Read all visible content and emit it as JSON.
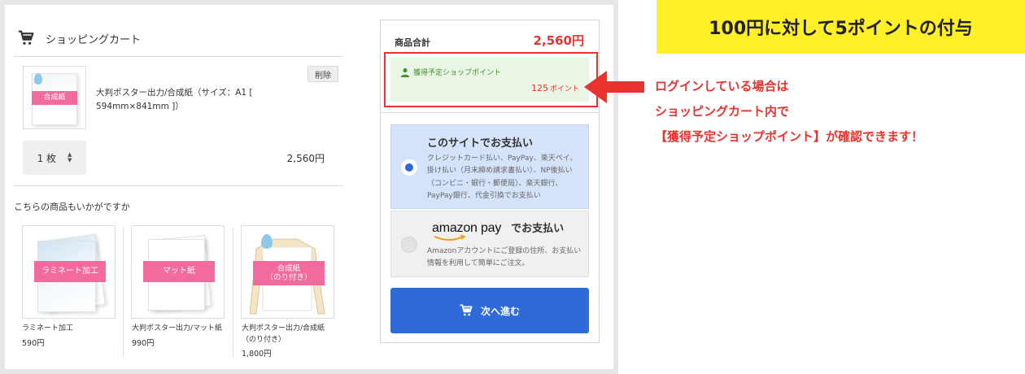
{
  "cart": {
    "title": "ショッピングカート",
    "item": {
      "thumb_label": "合成紙",
      "name": "大判ポスター出力/合成紙（サイズ：A1 [ 594mm×841mm ]）",
      "delete_label": "削除",
      "quantity": "1 枚",
      "price": "2,560円"
    }
  },
  "recommendations": {
    "title": "こちらの商品もいかがですか",
    "items": [
      {
        "label": "ラミネート加工",
        "name": "ラミネート加工",
        "price": "590円"
      },
      {
        "label": "マット紙",
        "name": "大判ポスター出力/マット紙",
        "price": "990円"
      },
      {
        "label": "合成紙\n（のり付き）",
        "name": "大判ポスター出力/合成紙（のり付き）",
        "price": "1,800円"
      }
    ]
  },
  "summary": {
    "subtotal_label": "商品合計",
    "subtotal_value": "2,560円",
    "points_label": "獲得予定ショップポイント",
    "points_value": "125",
    "points_unit": "ポイント",
    "pay_site": {
      "title": "このサイトでお支払い",
      "description": "クレジットカード払い、PayPay、楽天ペイ、掛け払い（月末締め請求書払い）、NP後払い（コンビニ・銀行・郵便局）、楽天銀行、PayPay銀行、代金引換でお支払い",
      "selected": true
    },
    "pay_amazon": {
      "logo_text": "amazon pay",
      "title": "でお支払い",
      "description": "Amazonアカウントにご登録の住所、お支払い情報を利用して簡単にご注文。",
      "selected": false
    },
    "next_label": "次へ進む"
  },
  "annotation": {
    "banner": "100円に対して5ポイントの付与",
    "callout_lines": [
      "ログインしている場合は",
      "ショッピングカート内で",
      "【獲得予定ショップポイント】が確認できます！"
    ]
  },
  "colors": {
    "accent_blue": "#2e6ad8",
    "price_red": "#e8332f",
    "points_green": "#4a8f2f",
    "banner_yellow": "#ffef26",
    "label_pink": "#f26a9e"
  },
  "icons": [
    "cart-icon",
    "user-icon",
    "sort-arrows-icon",
    "water-drop-icon",
    "arrow-left-icon"
  ]
}
